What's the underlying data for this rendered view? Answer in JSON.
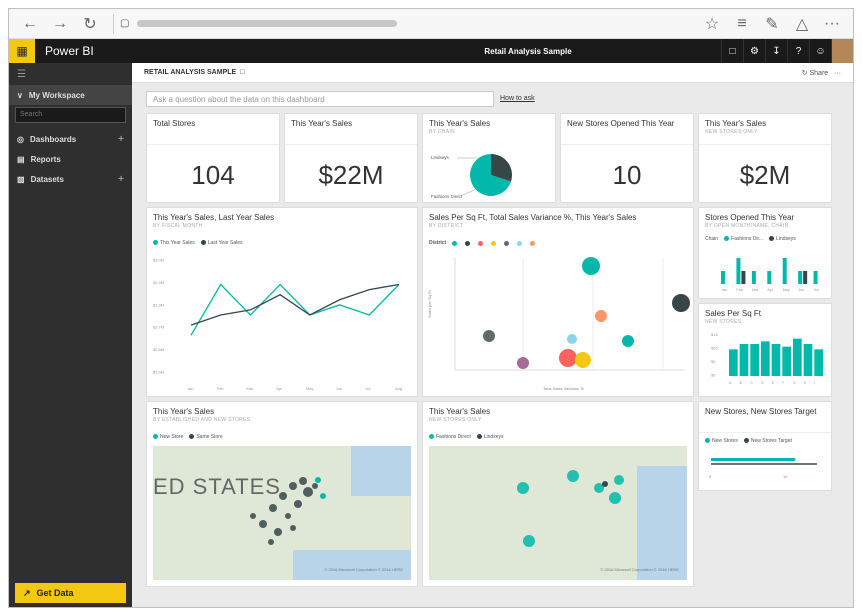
{
  "browser": {
    "back": "←",
    "forward": "→",
    "refresh": "↻",
    "lock": "🔒",
    "star": "☆",
    "menu": "≡",
    "more": "···"
  },
  "app": {
    "name": "Power BI",
    "center_title": "Retail Analysis Sample"
  },
  "nav": {
    "workspace": "My Workspace",
    "search_placeholder": "Search",
    "items": [
      {
        "label": "Dashboards"
      },
      {
        "label": "Reports"
      },
      {
        "label": "Datasets"
      }
    ],
    "get_data": "Get Data"
  },
  "dashboard": {
    "title": "RETAIL ANALYSIS SAMPLE",
    "share": "Share",
    "qa_placeholder": "Ask a question about the data on this dashboard",
    "qa_howto": "How to ask"
  },
  "tiles": {
    "total_stores": {
      "title": "Total Stores",
      "value": "104"
    },
    "sales": {
      "title": "This Year's Sales",
      "value": "$22M"
    },
    "sales_chain": {
      "title": "This Year's Sales",
      "subtitle": "BY CHAIN",
      "labels": [
        "Lindseys",
        "Fashions Direct"
      ]
    },
    "new_stores": {
      "title": "New Stores Opened This Year",
      "value": "10"
    },
    "new_sales": {
      "title": "This Year's Sales",
      "subtitle": "NEW STORES ONLY",
      "value": "$2M"
    },
    "line": {
      "title": "This Year's Sales, Last Year Sales",
      "subtitle": "BY FISCAL MONTH",
      "legend": [
        "This Year Sales",
        "Last Year Sales"
      ]
    },
    "scatter": {
      "title": "Sales Per Sq Ft, Total Sales Variance %, This Year's Sales",
      "subtitle": "BY DISTRICT",
      "legend_label": "District",
      "xlabel": "Total Sales Variance %",
      "ylabel": "Sales per Sq Ft"
    },
    "opened": {
      "title": "Stores Opened This Year",
      "subtitle": "BY OPEN MONTH/NAME, CHAIN",
      "legend_label": "Chain",
      "legend": [
        "Fashions Dir...",
        "Lindseys"
      ]
    },
    "sqft": {
      "title": "Sales Per Sq Ft",
      "subtitle": "NEW STORES"
    },
    "map1": {
      "title": "This Year's Sales",
      "subtitle": "BY ESTABLISHED AND NEW STORES",
      "legend": [
        "New Store",
        "Same Store"
      ],
      "map_label": "ED STATES",
      "copyright": "© 2016 Microsoft Corporation  © 2016 HERE"
    },
    "map2": {
      "title": "This Year's Sales",
      "subtitle": "NEW STORES ONLY",
      "legend": [
        "Fashions Direct",
        "Lindseys"
      ],
      "copyright": "© 2016 Microsoft Corporation  © 2016 HERE"
    },
    "target": {
      "title": "New Stores, New Stores Target",
      "legend": [
        "New Stores",
        "New Stores Target"
      ],
      "ticks": [
        "0",
        "10"
      ]
    }
  },
  "colors": {
    "teal": "#01b8aa",
    "dark": "#374649",
    "yellow": "#f2c811",
    "orange": "#fd625e"
  },
  "chart_data": [
    {
      "type": "pie",
      "title": "This Year's Sales",
      "categories": [
        "Lindseys",
        "Fashions Direct"
      ],
      "values": [
        30,
        70
      ]
    },
    {
      "type": "line",
      "title": "This Year's Sales, Last Year Sales",
      "categories": [
        "Jan",
        "Feb",
        "Mar",
        "Apr",
        "May",
        "Jun",
        "Jul",
        "Aug"
      ],
      "series": [
        {
          "name": "This Year Sales",
          "values": [
            2.4,
            2.9,
            2.6,
            2.9,
            2.6,
            2.7,
            2.6,
            2.9
          ]
        },
        {
          "name": "Last Year Sales",
          "values": [
            2.5,
            2.6,
            2.65,
            2.8,
            2.6,
            2.75,
            2.85,
            2.9
          ]
        }
      ],
      "ylim": [
        2.0,
        3.2
      ],
      "ytick_labels": [
        "$3.0M",
        "$2.9M",
        "$2.8M",
        "$2.7M",
        "$2.6M",
        "$2.5M"
      ],
      "xtick_labels": [
        "Jan",
        "Feb",
        "Mar",
        "Apr",
        "May",
        "Jun",
        "Jul",
        "Aug"
      ]
    },
    {
      "type": "bar",
      "title": "Stores Opened This Year",
      "categories": [
        "Jan",
        "Feb",
        "Mar",
        "Apr",
        "May",
        "Jun",
        "Jul"
      ],
      "series": [
        {
          "name": "Fashions Dir...",
          "values": [
            1,
            2,
            1,
            1,
            2,
            1,
            1
          ]
        },
        {
          "name": "Lindseys",
          "values": [
            0,
            1,
            0,
            0,
            0,
            1,
            0
          ]
        }
      ]
    },
    {
      "type": "bar",
      "title": "Sales Per Sq Ft",
      "categories": [
        "A",
        "B",
        "C",
        "D",
        "E",
        "F",
        "G",
        "H",
        "I"
      ],
      "values": [
        10,
        12,
        12,
        13,
        12,
        11,
        14,
        12,
        10
      ],
      "ytick_labels": [
        "$15",
        "$10",
        "$5",
        "$0"
      ]
    }
  ]
}
